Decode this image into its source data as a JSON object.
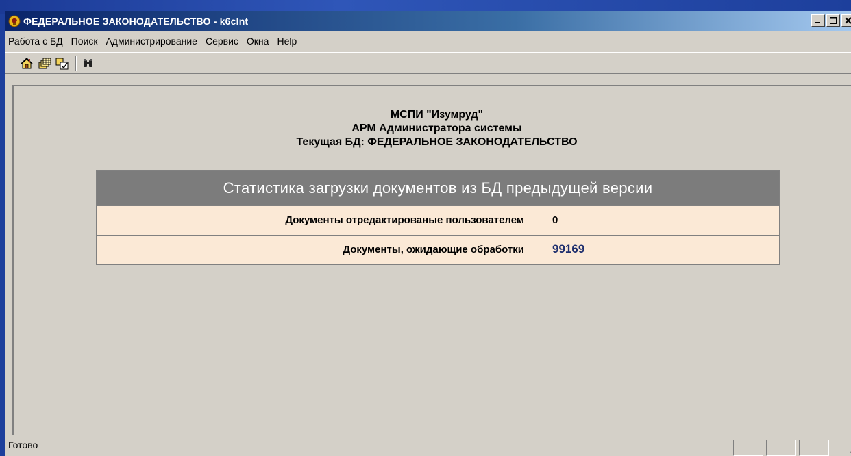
{
  "window": {
    "title": "ФЕДЕРАЛЬНОЕ ЗАКОНОДАТЕЛЬСТВО - k6clnt",
    "controls": [
      "minimize",
      "maximize",
      "close"
    ]
  },
  "menu": {
    "items": [
      "Работа с БД",
      "Поиск",
      "Администрирование",
      "Сервис",
      "Окна",
      "Help"
    ]
  },
  "toolbar": {
    "icons": [
      "home-icon",
      "tables-icon",
      "checklist-icon",
      "binoculars-icon"
    ]
  },
  "header": {
    "line1": "МСПИ \"Изумруд\"",
    "line2": "АРМ Администратора системы",
    "line3": "Текущая БД: ФЕДЕРАЛЬНОЕ ЗАКОНОДАТЕЛЬСТВО"
  },
  "stats": {
    "title": "Статистика загрузки документов из БД предыдущей версии",
    "rows": [
      {
        "label": "Документы отредактированые пользователем",
        "value": "0"
      },
      {
        "label": "Документы, ожидающие обработки",
        "value": "99169"
      }
    ]
  },
  "status": {
    "text": "Готово"
  },
  "colors": {
    "desktop": "#1d3f9c",
    "titlebar": "#0a246a",
    "stats_header": "#7c7c7c",
    "stats_row": "#fbe9d6",
    "value_accent": "#1e2f6e"
  }
}
